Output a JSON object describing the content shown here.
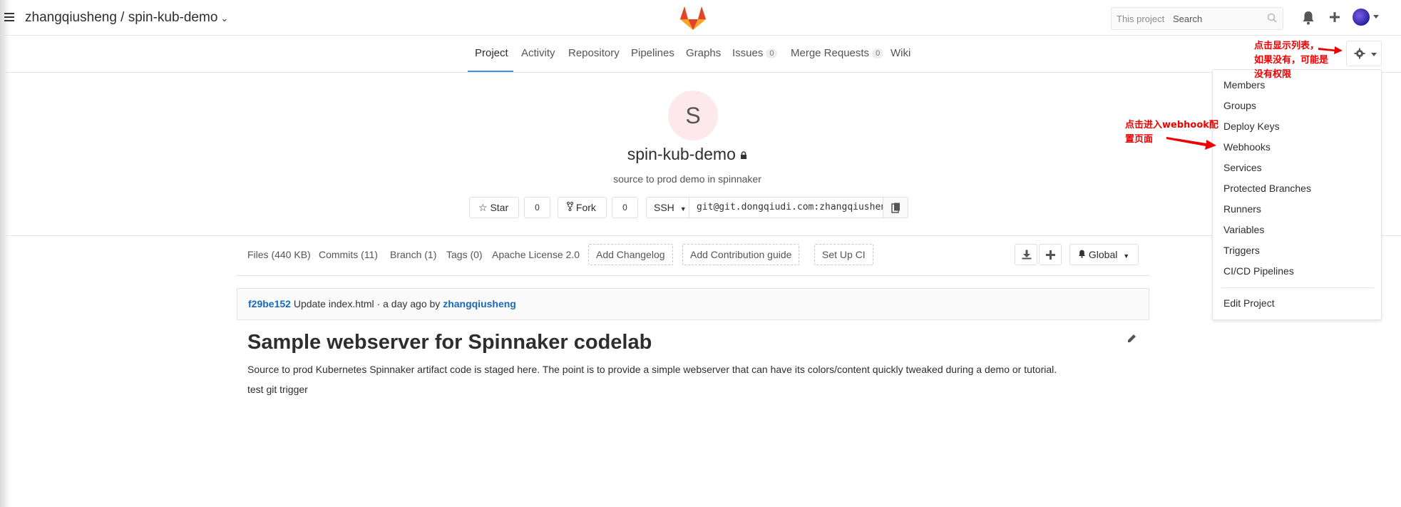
{
  "header": {
    "breadcrumb": "zhangqiusheng / spin-kub-demo",
    "search_scope": "This project",
    "search_placeholder": "Search"
  },
  "nav": {
    "tabs": [
      {
        "label": "Project"
      },
      {
        "label": "Activity"
      },
      {
        "label": "Repository"
      },
      {
        "label": "Pipelines"
      },
      {
        "label": "Graphs"
      },
      {
        "label": "Issues",
        "count": "0"
      },
      {
        "label": "Merge Requests",
        "count": "0"
      },
      {
        "label": "Wiki"
      }
    ]
  },
  "project": {
    "avatar_letter": "S",
    "name": "spin-kub-demo",
    "description": "source to prod demo in spinnaker",
    "star_label": "Star",
    "star_count": "0",
    "fork_label": "Fork",
    "fork_count": "0",
    "protocol": "SSH",
    "clone_url": "git@git.dongqiudi.com:zhangqiusheng/spin-kub-demo.git"
  },
  "stats": {
    "files": "Files (440 KB)",
    "commits": "Commits (11)",
    "branch": "Branch (1)",
    "tags": "Tags (0)",
    "license": "Apache License 2.0",
    "add_changelog": "Add Changelog",
    "add_contribution": "Add Contribution guide",
    "setup_ci": "Set Up CI",
    "notification": "Global"
  },
  "commit": {
    "sha": "f29be152",
    "message": "Update index.html · a day ago by",
    "author": "zhangqiusheng"
  },
  "readme": {
    "title": "Sample webserver for Spinnaker codelab",
    "paragraph": "Source to prod Kubernetes Spinnaker artifact code is staged here. The point is to provide a simple webserver that can have its colors/content quickly tweaked during a demo or tutorial.",
    "line2": "test git trigger"
  },
  "settings_menu": {
    "items": [
      "Members",
      "Groups",
      "Deploy Keys",
      "Webhooks",
      "Services",
      "Protected Branches",
      "Runners",
      "Variables",
      "Triggers",
      "CI/CD Pipelines"
    ],
    "edit": "Edit Project"
  },
  "annotations": {
    "gear_note": [
      "点击显示列表，",
      "如果没有，可能是",
      "没有权限"
    ],
    "webhook_note": [
      "点击进入webhook配",
      "置页面"
    ]
  },
  "colors": {
    "accent": "#4a8bee",
    "link": "#1b69b6",
    "annotation": "#ee0000",
    "gitlab_orange": "#e24329"
  },
  "icons": [
    "hamburger-icon",
    "gitlab-logo-icon",
    "search-icon",
    "bell-icon",
    "plus-icon",
    "user-avatar",
    "gear-icon",
    "lock-icon",
    "star-icon",
    "fork-icon",
    "clipboard-icon",
    "download-icon",
    "bell-icon",
    "pencil-icon"
  ]
}
